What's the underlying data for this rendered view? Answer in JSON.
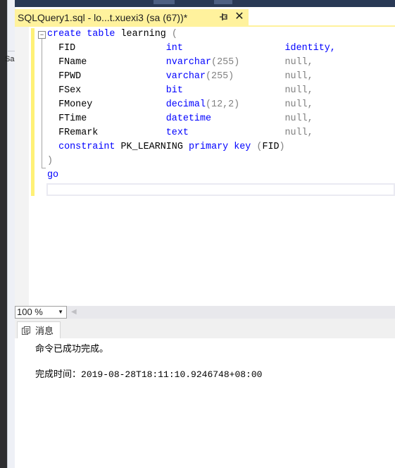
{
  "left_panel": {
    "cut_label": "Sa"
  },
  "document_tab": {
    "title": "SQLQuery1.sql - lo...t.xuexi3 (sa (67))*",
    "pin_icon": "pin-icon",
    "close_glyph": "✕"
  },
  "editor": {
    "fold_glyph": "−",
    "lines": [
      {
        "kind": "create",
        "text": "create table learning ("
      },
      {
        "kind": "col",
        "name": "FID",
        "type": "int",
        "args": "",
        "attr": "identity,"
      },
      {
        "kind": "col",
        "name": "FName",
        "type": "nvarchar",
        "args": "(255)",
        "attr": "null,"
      },
      {
        "kind": "col",
        "name": "FPWD",
        "type": "varchar",
        "args": "(255)",
        "attr": "null,"
      },
      {
        "kind": "col",
        "name": "FSex",
        "type": "bit",
        "args": "",
        "attr": "null,"
      },
      {
        "kind": "col",
        "name": "FMoney",
        "type": "decimal",
        "args": "(12,2)",
        "attr": "null,"
      },
      {
        "kind": "col",
        "name": "FTime",
        "type": "datetime",
        "args": "",
        "attr": "null,"
      },
      {
        "kind": "col",
        "name": "FRemark",
        "type": "text",
        "args": "",
        "attr": "null,"
      },
      {
        "kind": "constraint",
        "text": "constraint PK_LEARNING primary key (FID)"
      },
      {
        "kind": "close",
        "text": ")"
      },
      {
        "kind": "go",
        "text": "go"
      },
      {
        "kind": "blank",
        "text": ""
      }
    ]
  },
  "zoom": {
    "value": "100 %",
    "arrow": "▼",
    "scroll_left_glyph": "◀"
  },
  "results": {
    "tab_label": "消息",
    "tab_icon": "messages-icon",
    "message": "命令已成功完成。",
    "time_label": "完成时间：",
    "time_value": "2019-08-28T18:11:10.9246748+08:00"
  }
}
